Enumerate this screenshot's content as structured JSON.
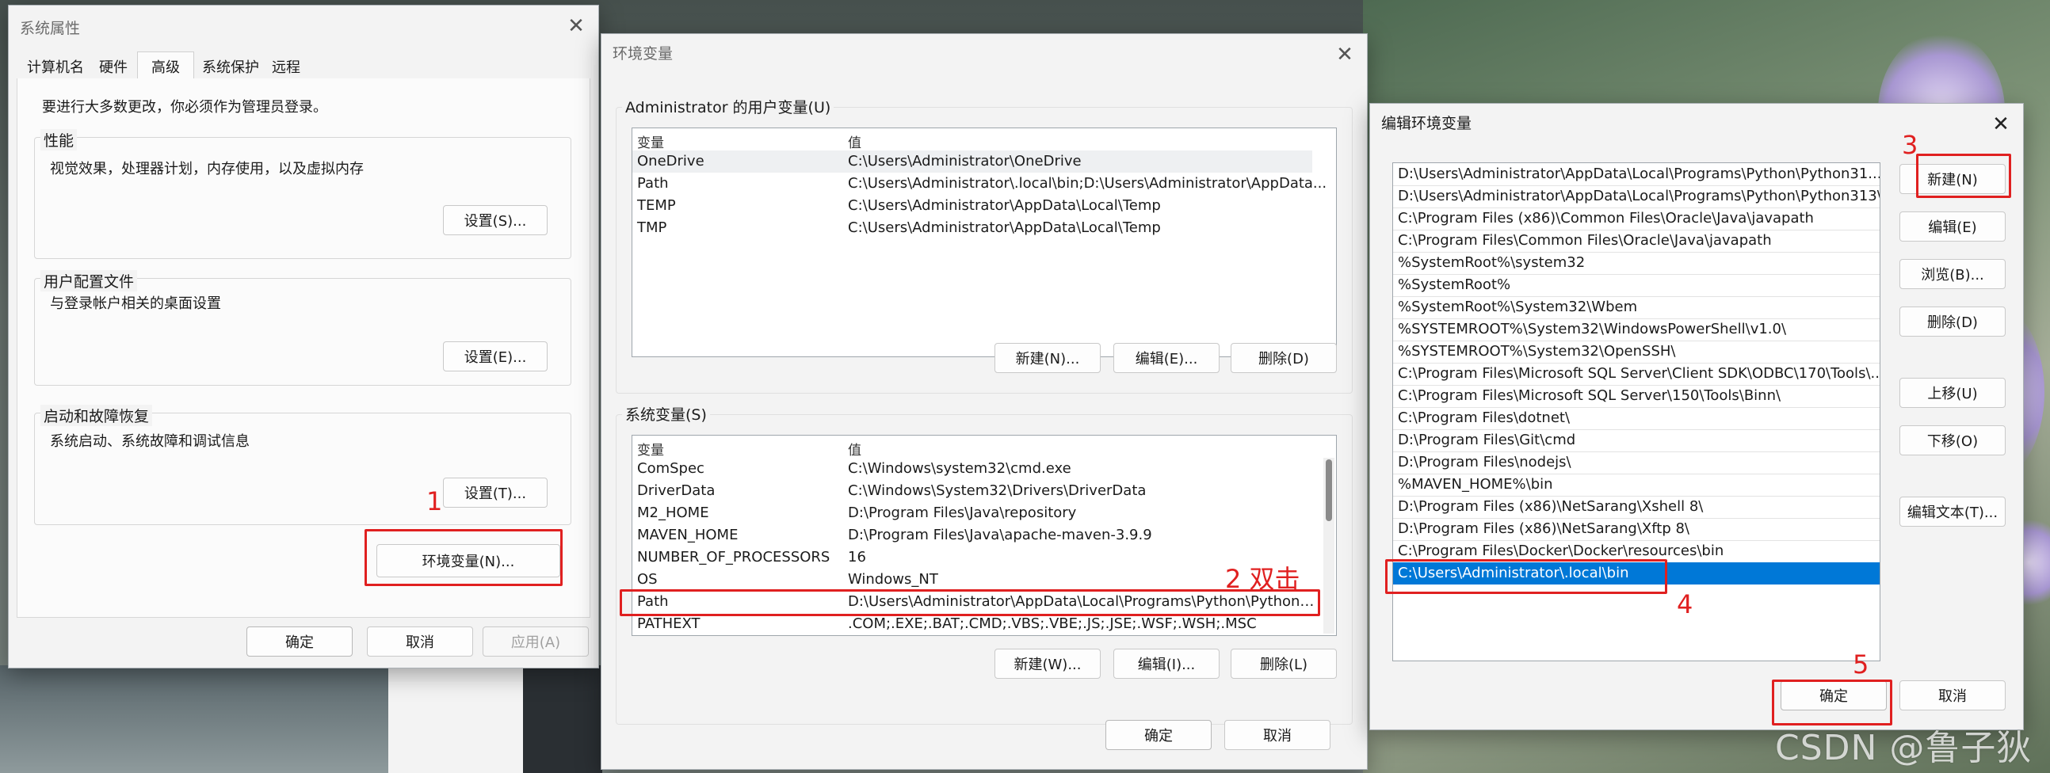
{
  "system_properties": {
    "title": "系统属性",
    "tabs": [
      "计算机名",
      "硬件",
      "高级",
      "系统保护",
      "远程"
    ],
    "active_tab": "高级",
    "admin_notice": "要进行大多数更改，你必须作为管理员登录。",
    "performance": {
      "title": "性能",
      "desc": "视觉效果，处理器计划，内存使用，以及虚拟内存",
      "button": "设置(S)..."
    },
    "user_profiles": {
      "title": "用户配置文件",
      "desc": "与登录帐户相关的桌面设置",
      "button": "设置(E)..."
    },
    "startup_recovery": {
      "title": "启动和故障恢复",
      "desc": "系统启动、系统故障和调试信息",
      "button": "设置(T)..."
    },
    "env_vars_button": "环境变量(N)...",
    "ok": "确定",
    "cancel": "取消",
    "apply": "应用(A)"
  },
  "env_vars": {
    "title": "环境变量",
    "user_section_title": "Administrator 的用户变量(U)",
    "col_var": "变量",
    "col_val": "值",
    "user_vars": [
      {
        "name": "OneDrive",
        "value": "C:\\Users\\Administrator\\OneDrive"
      },
      {
        "name": "Path",
        "value": "C:\\Users\\Administrator\\.local\\bin;D:\\Users\\Administrator\\AppData..."
      },
      {
        "name": "TEMP",
        "value": "C:\\Users\\Administrator\\AppData\\Local\\Temp"
      },
      {
        "name": "TMP",
        "value": "C:\\Users\\Administrator\\AppData\\Local\\Temp"
      }
    ],
    "user_buttons": {
      "new": "新建(N)...",
      "edit": "编辑(E)...",
      "delete": "删除(D)"
    },
    "system_section_title": "系统变量(S)",
    "system_vars": [
      {
        "name": "ComSpec",
        "value": "C:\\Windows\\system32\\cmd.exe"
      },
      {
        "name": "DriverData",
        "value": "C:\\Windows\\System32\\Drivers\\DriverData"
      },
      {
        "name": "M2_HOME",
        "value": "D:\\Program Files\\Java\\repository"
      },
      {
        "name": "MAVEN_HOME",
        "value": "D:\\Program Files\\Java\\apache-maven-3.9.9"
      },
      {
        "name": "NUMBER_OF_PROCESSORS",
        "value": "16"
      },
      {
        "name": "OS",
        "value": "Windows_NT"
      },
      {
        "name": "Path",
        "value": "D:\\Users\\Administrator\\AppData\\Local\\Programs\\Python\\Python3..."
      },
      {
        "name": "PATHEXT",
        "value": ".COM;.EXE;.BAT;.CMD;.VBS;.VBE;.JS;.JSE;.WSF;.WSH;.MSC"
      }
    ],
    "system_buttons": {
      "new": "新建(W)...",
      "edit": "编辑(I)...",
      "delete": "删除(L)"
    },
    "ok": "确定",
    "cancel": "取消"
  },
  "edit_env": {
    "title": "编辑环境变量",
    "paths": [
      "D:\\Users\\Administrator\\AppData\\Local\\Programs\\Python\\Python31...",
      "D:\\Users\\Administrator\\AppData\\Local\\Programs\\Python\\Python313\\",
      "C:\\Program Files (x86)\\Common Files\\Oracle\\Java\\javapath",
      "C:\\Program Files\\Common Files\\Oracle\\Java\\javapath",
      "%SystemRoot%\\system32",
      "%SystemRoot%",
      "%SystemRoot%\\System32\\Wbem",
      "%SYSTEMROOT%\\System32\\WindowsPowerShell\\v1.0\\",
      "%SYSTEMROOT%\\System32\\OpenSSH\\",
      "C:\\Program Files\\Microsoft SQL Server\\Client SDK\\ODBC\\170\\Tools\\...",
      "C:\\Program Files\\Microsoft SQL Server\\150\\Tools\\Binn\\",
      "C:\\Program Files\\dotnet\\",
      "D:\\Program Files\\Git\\cmd",
      "D:\\Program Files\\nodejs\\",
      "%MAVEN_HOME%\\bin",
      "D:\\Program Files (x86)\\NetSarang\\Xshell 8\\",
      "D:\\Program Files (x86)\\NetSarang\\Xftp 8\\",
      "C:\\Program Files\\Docker\\Docker\\resources\\bin",
      "C:\\Users\\Administrator\\.local\\bin"
    ],
    "buttons": {
      "new": "新建(N)",
      "edit": "编辑(E)",
      "browse": "浏览(B)...",
      "delete": "删除(D)",
      "move_up": "上移(U)",
      "move_down": "下移(O)",
      "edit_text": "编辑文本(T)..."
    },
    "ok": "确定",
    "cancel": "取消"
  },
  "annotations": {
    "step1": "1",
    "step2": "2 双击",
    "step3": "3",
    "step4": "4",
    "step5": "5"
  },
  "watermark": "CSDN @鲁子狄",
  "colors": {
    "selection": "#0078d7",
    "annotation": "#e02020",
    "window_bg": "#f3f3f3"
  }
}
